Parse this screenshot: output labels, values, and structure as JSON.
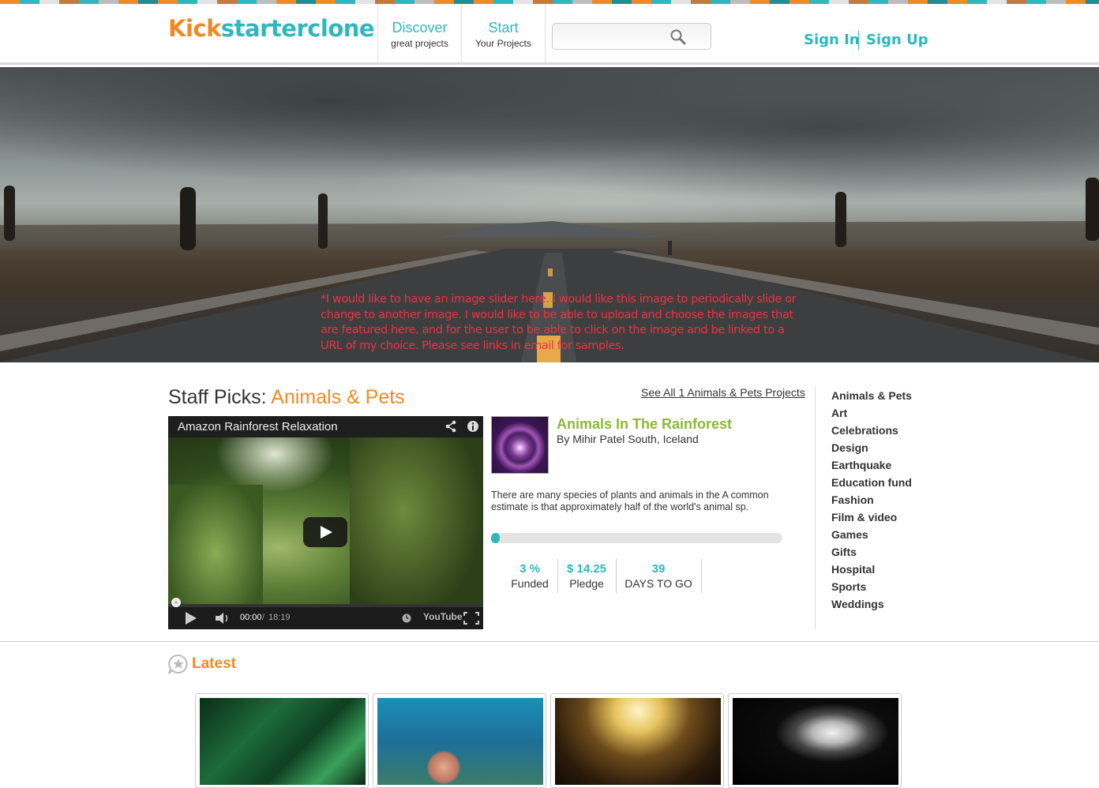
{
  "colors": {
    "teal": "#2eb8bd",
    "orange": "#f08a24",
    "green": "#8bb83a",
    "note_red": "#e8343f"
  },
  "header": {
    "logo_part1": "Kick",
    "logo_part2": "starterclone",
    "nav": [
      {
        "big": "Discover",
        "small": "great projects"
      },
      {
        "big": "Start",
        "small": "Your Projects"
      }
    ],
    "search_placeholder": "",
    "search_icon": "search-icon",
    "sign_in": "Sign In",
    "sign_up": "Sign Up"
  },
  "hero": {
    "note": "*I would like to have an image slider here. I would like this image to periodically slide or change to another image. I would like to be able to upload and choose the images that are featured here, and for the user to be able to click on the image and be  linked to a URL of my choice. Please see links in email for samples."
  },
  "staff": {
    "prefix": "Staff Picks: ",
    "category": "Animals & Pets",
    "see_all": "See All 1 Animals & Pets Projects"
  },
  "video": {
    "title": "Amazon Rainforest Relaxation",
    "time_current": "00:00",
    "time_sep": " / ",
    "time_total": "18:19",
    "youtube": "YouTube"
  },
  "project": {
    "title": "Animals In The Rainforest",
    "by": "By Mihir Patel South, Iceland",
    "description": "There are many species of plants and animals in the A common estimate is that approximately half of the world's animal sp.",
    "progress_percent": 3,
    "stats": [
      {
        "value": "3 %",
        "label": "Funded"
      },
      {
        "value": "$ 14.25",
        "label": "Pledge"
      },
      {
        "value": "39",
        "label": "DAYS TO GO"
      }
    ]
  },
  "categories": [
    "Animals & Pets",
    "Art",
    "Celebrations",
    "Design",
    "Earthquake",
    "Education fund",
    "Fashion",
    "Film & video",
    "Games",
    "Gifts",
    "Hospital",
    "Sports",
    "Weddings"
  ],
  "latest": {
    "title": "Latest",
    "icon": "star-bubble-icon"
  }
}
